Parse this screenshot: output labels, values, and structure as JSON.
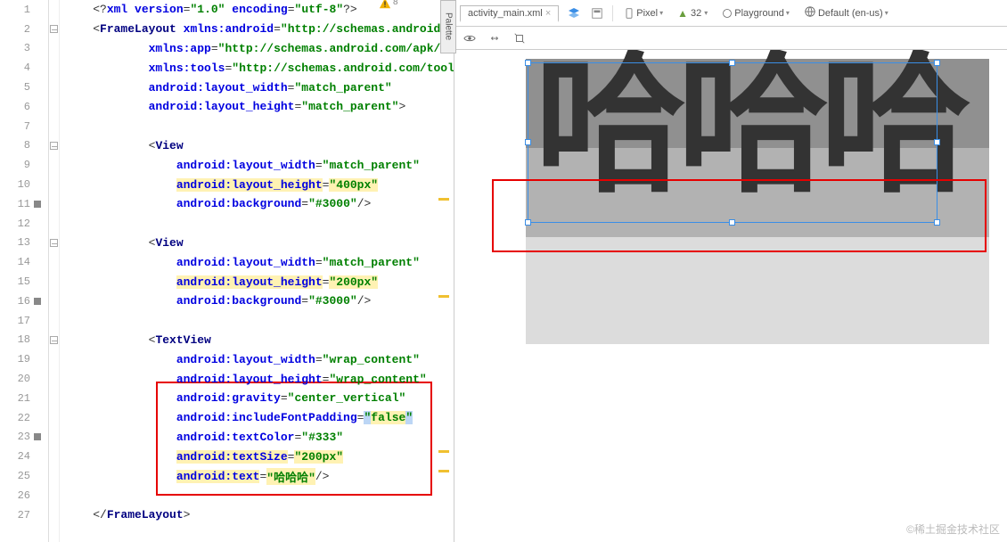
{
  "editor": {
    "lines": [
      {
        "num": 1,
        "indent": 1,
        "raw": "<?xml version=\"1.0\" encoding=\"utf-8\"?>",
        "parts": [
          {
            "t": "<?",
            "c": "tok-punc"
          },
          {
            "t": "xml version",
            "c": "tok-attr"
          },
          {
            "t": "=",
            "c": "tok-punc"
          },
          {
            "t": "\"1.0\"",
            "c": "tok-string"
          },
          {
            "t": " encoding",
            "c": "tok-attr"
          },
          {
            "t": "=",
            "c": "tok-punc"
          },
          {
            "t": "\"utf-8\"",
            "c": "tok-string"
          },
          {
            "t": "?>",
            "c": "tok-punc"
          }
        ]
      },
      {
        "num": 2,
        "indent": 1,
        "parts": [
          {
            "t": "<",
            "c": "tok-punc"
          },
          {
            "t": "FrameLayout ",
            "c": "tok-tag"
          },
          {
            "t": "xmlns:android",
            "c": "tok-attr"
          },
          {
            "t": "=",
            "c": "tok-punc"
          },
          {
            "t": "\"http://schemas.android.com",
            "c": "tok-string"
          }
        ]
      },
      {
        "num": 3,
        "indent": 3,
        "parts": [
          {
            "t": "xmlns:app",
            "c": "tok-attr"
          },
          {
            "t": "=",
            "c": "tok-punc"
          },
          {
            "t": "\"http://schemas.android.com/apk/res-auto",
            "c": "tok-string"
          }
        ]
      },
      {
        "num": 4,
        "indent": 3,
        "parts": [
          {
            "t": "xmlns:tools",
            "c": "tok-attr"
          },
          {
            "t": "=",
            "c": "tok-punc"
          },
          {
            "t": "\"http://schemas.android.com/tools\"",
            "c": "tok-string"
          }
        ]
      },
      {
        "num": 5,
        "indent": 3,
        "parts": [
          {
            "t": "android:layout_width",
            "c": "tok-attr"
          },
          {
            "t": "=",
            "c": "tok-punc"
          },
          {
            "t": "\"match_parent\"",
            "c": "tok-string"
          }
        ]
      },
      {
        "num": 6,
        "indent": 3,
        "parts": [
          {
            "t": "android:layout_height",
            "c": "tok-attr"
          },
          {
            "t": "=",
            "c": "tok-punc"
          },
          {
            "t": "\"match_parent\"",
            "c": "tok-string"
          },
          {
            "t": ">",
            "c": "tok-punc"
          }
        ]
      },
      {
        "num": 7,
        "indent": 0,
        "parts": []
      },
      {
        "num": 8,
        "indent": 3,
        "parts": [
          {
            "t": "<",
            "c": "tok-punc"
          },
          {
            "t": "View",
            "c": "tok-tag"
          }
        ]
      },
      {
        "num": 9,
        "indent": 4,
        "parts": [
          {
            "t": "android:layout_width",
            "c": "tok-attr"
          },
          {
            "t": "=",
            "c": "tok-punc"
          },
          {
            "t": "\"match_parent\"",
            "c": "tok-string"
          }
        ]
      },
      {
        "num": 10,
        "indent": 4,
        "parts": [
          {
            "t": "android:layout_height",
            "c": "tok-attr",
            "hl": "hl-yellow"
          },
          {
            "t": "=",
            "c": "tok-punc"
          },
          {
            "t": "\"400px\"",
            "c": "tok-string",
            "hl": "hl-yellow"
          }
        ]
      },
      {
        "num": 11,
        "indent": 4,
        "mark": true,
        "parts": [
          {
            "t": "android:background",
            "c": "tok-attr"
          },
          {
            "t": "=",
            "c": "tok-punc"
          },
          {
            "t": "\"#3000\"",
            "c": "tok-string"
          },
          {
            "t": "/>",
            "c": "tok-punc"
          }
        ],
        "ym": true
      },
      {
        "num": 12,
        "indent": 0,
        "parts": []
      },
      {
        "num": 13,
        "indent": 3,
        "parts": [
          {
            "t": "<",
            "c": "tok-punc"
          },
          {
            "t": "View",
            "c": "tok-tag"
          }
        ]
      },
      {
        "num": 14,
        "indent": 4,
        "parts": [
          {
            "t": "android:layout_width",
            "c": "tok-attr"
          },
          {
            "t": "=",
            "c": "tok-punc"
          },
          {
            "t": "\"match_parent\"",
            "c": "tok-string"
          }
        ]
      },
      {
        "num": 15,
        "indent": 4,
        "parts": [
          {
            "t": "android:layout_height",
            "c": "tok-attr",
            "hl": "hl-yellow"
          },
          {
            "t": "=",
            "c": "tok-punc"
          },
          {
            "t": "\"200px\"",
            "c": "tok-string",
            "hl": "hl-yellow"
          }
        ]
      },
      {
        "num": 16,
        "indent": 4,
        "mark": true,
        "parts": [
          {
            "t": "android:background",
            "c": "tok-attr"
          },
          {
            "t": "=",
            "c": "tok-punc"
          },
          {
            "t": "\"#3000\"",
            "c": "tok-string"
          },
          {
            "t": "/>",
            "c": "tok-punc"
          }
        ],
        "ym": true
      },
      {
        "num": 17,
        "indent": 0,
        "parts": []
      },
      {
        "num": 18,
        "indent": 3,
        "parts": [
          {
            "t": "<",
            "c": "tok-punc"
          },
          {
            "t": "TextView",
            "c": "tok-tag"
          }
        ]
      },
      {
        "num": 19,
        "indent": 4,
        "parts": [
          {
            "t": "android:layout_width",
            "c": "tok-attr"
          },
          {
            "t": "=",
            "c": "tok-punc"
          },
          {
            "t": "\"wrap_content\"",
            "c": "tok-string"
          }
        ]
      },
      {
        "num": 20,
        "indent": 4,
        "parts": [
          {
            "t": "android:layout_height",
            "c": "tok-attr"
          },
          {
            "t": "=",
            "c": "tok-punc"
          },
          {
            "t": "\"wrap_content\"",
            "c": "tok-string"
          }
        ]
      },
      {
        "num": 21,
        "indent": 4,
        "parts": [
          {
            "t": "android:gravity",
            "c": "tok-attr"
          },
          {
            "t": "=",
            "c": "tok-punc"
          },
          {
            "t": "\"center_vertical\"",
            "c": "tok-string"
          }
        ]
      },
      {
        "num": 22,
        "indent": 4,
        "current": true,
        "parts": [
          {
            "t": "android:includeFontPadding",
            "c": "tok-attr"
          },
          {
            "t": "=",
            "c": "tok-punc"
          },
          {
            "t": "\"",
            "c": "tok-string",
            "hl": "hl-blue"
          },
          {
            "t": "false",
            "c": "tok-string",
            "hl": "hl-yellow"
          },
          {
            "t": "\"",
            "c": "tok-string",
            "hl": "hl-blue"
          }
        ]
      },
      {
        "num": 23,
        "indent": 4,
        "mark": true,
        "parts": [
          {
            "t": "android:textColor",
            "c": "tok-attr"
          },
          {
            "t": "=",
            "c": "tok-punc"
          },
          {
            "t": "\"#333\"",
            "c": "tok-string"
          }
        ]
      },
      {
        "num": 24,
        "indent": 4,
        "parts": [
          {
            "t": "android:textSize",
            "c": "tok-attr",
            "hl": "hl-yellow"
          },
          {
            "t": "=",
            "c": "tok-punc"
          },
          {
            "t": "\"200px\"",
            "c": "tok-string",
            "hl": "hl-yellow"
          }
        ],
        "ym": true
      },
      {
        "num": 25,
        "indent": 4,
        "parts": [
          {
            "t": "android:text",
            "c": "tok-attr",
            "hl": "hl-yellow"
          },
          {
            "t": "=",
            "c": "tok-punc"
          },
          {
            "t": "\"哈哈哈\"",
            "c": "tok-string",
            "hl": "hl-yellow"
          },
          {
            "t": "/>",
            "c": "tok-punc"
          }
        ],
        "ym": true
      },
      {
        "num": 26,
        "indent": 0,
        "parts": []
      },
      {
        "num": 27,
        "indent": 1,
        "parts": [
          {
            "t": "</",
            "c": "tok-punc"
          },
          {
            "t": "FrameLayout",
            "c": "tok-tag"
          },
          {
            "t": ">",
            "c": "tok-punc"
          }
        ]
      }
    ],
    "warn_count": "8"
  },
  "toolbar": {
    "tab": "activity_main.xml",
    "device": "Pixel",
    "api": "32",
    "theme": "Playground",
    "locale": "Default (en-us)",
    "palette_label": "Palette"
  },
  "preview": {
    "text": "哈哈哈"
  },
  "watermark": "©稀土掘金技术社区"
}
